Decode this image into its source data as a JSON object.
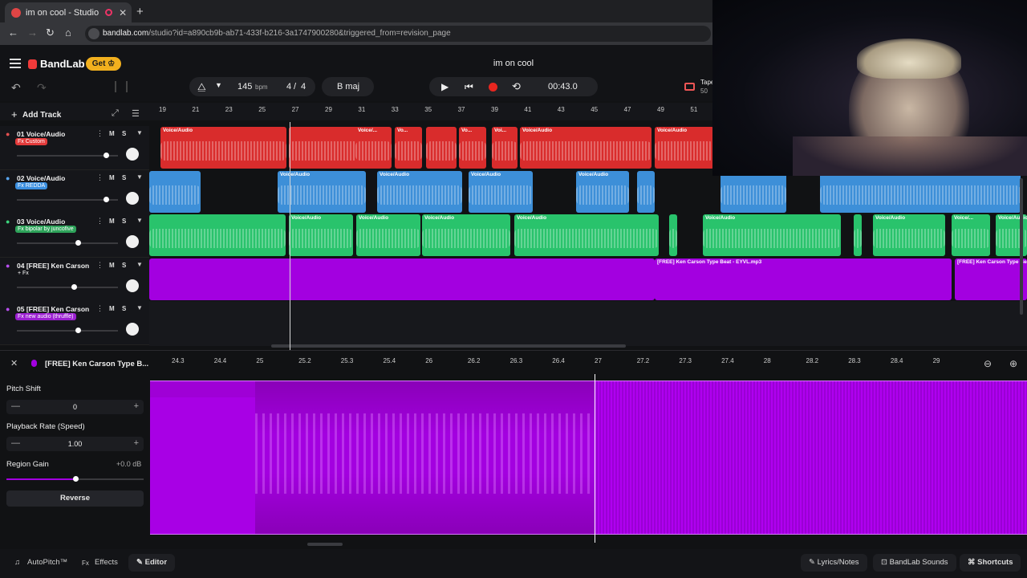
{
  "browser": {
    "tab_title": "im on cool - Studio",
    "tab_close": "✕",
    "new_tab": "+",
    "url_host": "bandlab.com",
    "url_path": "/studio?id=a890cb9b-ab71-433f-b216-3a1747900280&triggered_from=revision_page",
    "back": "←",
    "forward": "→",
    "reload": "↻",
    "home": "⌂"
  },
  "app": {
    "logo": "BandLab",
    "get_label": "Get ♔",
    "song_title": "im on cool",
    "undo": "↶",
    "redo": "↷",
    "tempo_value": "145",
    "tempo_unit": "bpm",
    "time_sig_num": "4",
    "time_sig_sep": "/",
    "time_sig_den": "4",
    "key": "B maj",
    "time_display": "00:43.0",
    "tape_label": "Tape",
    "tape_value": "50",
    "add_track": "Add Track",
    "add_plus": "+"
  },
  "ruler_ticks": [
    "19",
    "21",
    "23",
    "25",
    "27",
    "29",
    "31",
    "33",
    "35",
    "37",
    "39",
    "41",
    "43",
    "45",
    "47",
    "49",
    "51"
  ],
  "tracks": [
    {
      "name": "01  Voice/Audio",
      "fx": "Fx Custom",
      "fx_color": "#e33b3b",
      "m": "M",
      "s": "S",
      "vol": 0.88,
      "color": "#d92c2c",
      "icon_color": "#e35050"
    },
    {
      "name": "02  Voice/Audio",
      "fx": "Fx REDDA",
      "fx_color": "#3b8fe0",
      "m": "M",
      "s": "S",
      "vol": 0.88,
      "color": "#3d8fd8",
      "icon_color": "#58a5f0"
    },
    {
      "name": "03  Voice/Audio",
      "fx": "Fx bipolar by juncofive",
      "fx_color": "#2ea35a",
      "m": "M",
      "s": "S",
      "vol": 0.6,
      "color": "#29c36c",
      "icon_color": "#3bd47c"
    },
    {
      "name": "04  [FREE] Ken Carson ...",
      "fx": "+ Fx",
      "fx_color": "transparent",
      "m": "M",
      "s": "S",
      "vol": 0.56,
      "color": "#a300e0",
      "icon_color": "#b84ef0"
    },
    {
      "name": "05  [FREE] Ken Carson ...",
      "fx": "Fx  new audio (thruffle)",
      "fx_color": "#9b1fd1",
      "m": "M",
      "s": "S",
      "vol": 0.6,
      "color": "#a300e0",
      "icon_color": "#b84ef0"
    }
  ],
  "clip_labels": {
    "voice": "Voice/Audio",
    "voice_short": "Voice/...",
    "voi": "Voi...",
    "vo": "Vo...",
    "beat1": "[FREE] Ken Carson Type Beat - EYVL.mp3",
    "beat2": "[FREE] Ken Carson Type Beat"
  },
  "editor": {
    "clip_name": "[FREE] Ken Carson Type B...",
    "close": "✕",
    "pitch_label": "Pitch Shift",
    "pitch_value": "0",
    "rate_label": "Playback Rate (Speed)",
    "rate_value": "1.00",
    "gain_label": "Region Gain",
    "gain_value": "+0.0 dB",
    "gain_level": 0.5,
    "reverse_label": "Reverse",
    "minus": "—",
    "plus": "+",
    "ticks": [
      "24.3",
      "24.4",
      "25",
      "25.2",
      "25.3",
      "25.4",
      "26",
      "26.2",
      "26.3",
      "26.4",
      "27",
      "27.2",
      "27.3",
      "27.4",
      "28",
      "28.2",
      "28.3",
      "28.4",
      "29"
    ]
  },
  "bottom": {
    "autopitch": "AutoPitch™",
    "effects": "Effects",
    "editor": "Editor",
    "lyrics": "Lyrics/Notes",
    "sounds": "BandLab Sounds",
    "shortcuts": "Shortcuts"
  },
  "colors": {
    "red": "#d92c2c",
    "blue": "#3d8fd8",
    "green": "#29c36c",
    "purple": "#a300e0",
    "accent": "#f2b01e"
  }
}
